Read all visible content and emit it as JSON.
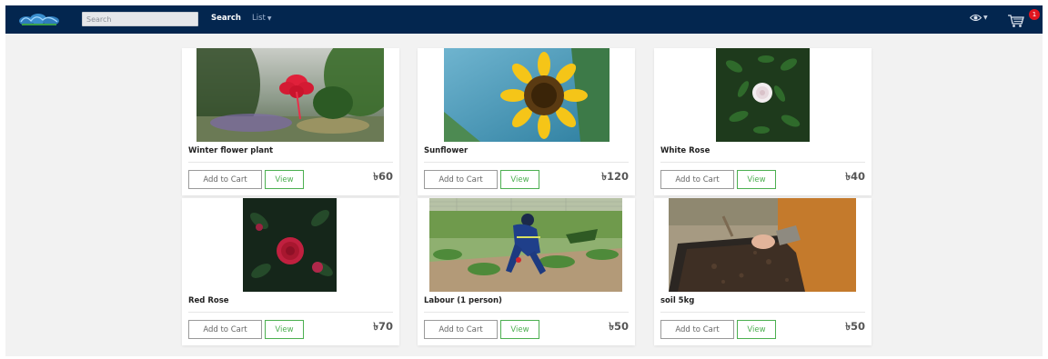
{
  "header": {
    "search_placeholder": "Search",
    "search_label": "Search",
    "list_label": "List",
    "cart_count": "1"
  },
  "products": [
    {
      "name": "Winter flower plant",
      "price": "৳60",
      "add_label": "Add to Cart",
      "view_label": "View"
    },
    {
      "name": "Sunflower",
      "price": "৳120",
      "add_label": "Add to Cart",
      "view_label": "View"
    },
    {
      "name": "White Rose",
      "price": "৳40",
      "add_label": "Add to Cart",
      "view_label": "View"
    },
    {
      "name": "Red Rose",
      "price": "৳70",
      "add_label": "Add to Cart",
      "view_label": "View"
    },
    {
      "name": "Labour (1 person)",
      "price": "৳50",
      "add_label": "Add to Cart",
      "view_label": "View"
    },
    {
      "name": "soil 5kg",
      "price": "৳50",
      "add_label": "Add to Cart",
      "view_label": "View"
    }
  ],
  "colors": {
    "navbar": "#03264f",
    "view_button": "#4caf50",
    "badge": "#e0151f"
  }
}
